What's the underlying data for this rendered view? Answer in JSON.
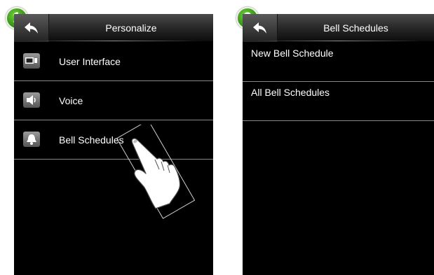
{
  "steps": [
    "1",
    "2"
  ],
  "screen1": {
    "title": "Personalize",
    "menu": [
      {
        "label": "User Interface",
        "icon": "display-icon"
      },
      {
        "label": "Voice",
        "icon": "speaker-icon"
      },
      {
        "label": "Bell Schedules",
        "icon": "bell-icon"
      }
    ]
  },
  "screen2": {
    "title": "Bell Schedules",
    "items": [
      {
        "label": "New Bell Schedule"
      },
      {
        "label": "All Bell Schedules"
      }
    ]
  },
  "colors": {
    "screen_background": "#000000",
    "text": "#ffffff",
    "badge_green": "#3f9d1c",
    "divider": "#8a8a8a"
  }
}
